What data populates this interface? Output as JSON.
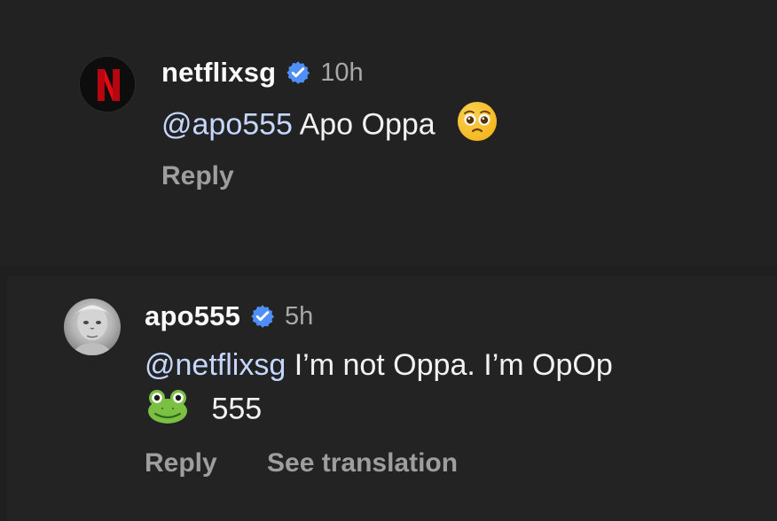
{
  "comments": [
    {
      "username": "netflixsg",
      "timestamp": "10h",
      "mention": "@apo555",
      "text": " Apo Oppa",
      "reply_label": "Reply",
      "emoji_icon": "pleading-face-icon"
    },
    {
      "username": "apo555",
      "timestamp": "5h",
      "mention": "@netflixsg",
      "text": " I’m not Oppa. I’m OpOp",
      "second_line_text": "555",
      "reply_label": "Reply",
      "translate_label": "See translation",
      "emoji_icon": "frog-face-icon"
    }
  ],
  "colors": {
    "background": "#1f1f1f",
    "text_primary": "#f5f5f5",
    "text_secondary": "#a8a8a8",
    "verified_blue": "#4f8ff7",
    "mention_blue": "#c5d7ff",
    "netflix_red": "#e50914"
  }
}
